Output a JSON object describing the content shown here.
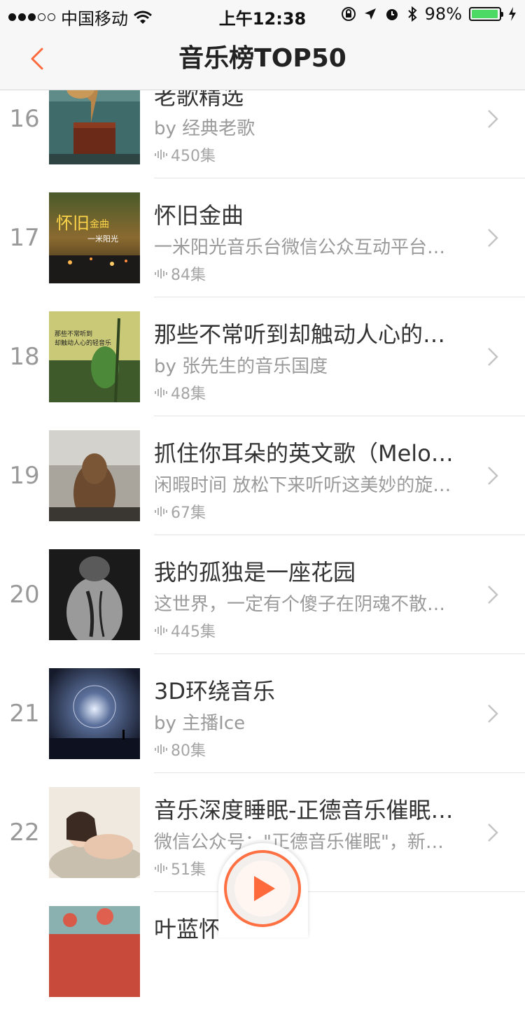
{
  "status_bar": {
    "carrier": "中国移动",
    "time": "上午12:38",
    "battery": "98%",
    "battery_level": 0.98
  },
  "nav": {
    "title": "音乐榜TOP50",
    "back_icon": "chevron-left-icon"
  },
  "items": [
    {
      "rank": "16",
      "title": "老歌精选",
      "subtitle": "by 经典老歌",
      "episodes": "450集"
    },
    {
      "rank": "17",
      "title": "怀旧金曲",
      "subtitle": "一米阳光音乐台微信公众互动平台…",
      "episodes": "84集"
    },
    {
      "rank": "18",
      "title": "那些不常听到却触动人心的…",
      "subtitle": "by 张先生的音乐国度",
      "episodes": "48集"
    },
    {
      "rank": "19",
      "title": "抓住你耳朵的英文歌（Melo…",
      "subtitle": "闲暇时间 放松下来听听这美妙的旋…",
      "episodes": "67集"
    },
    {
      "rank": "20",
      "title": "我的孤独是一座花园",
      "subtitle": "这世界，一定有个傻子在阴魂不散…",
      "episodes": "445集"
    },
    {
      "rank": "21",
      "title": "3D环绕音乐",
      "subtitle": "by 主播Ice",
      "episodes": "80集"
    },
    {
      "rank": "22",
      "title": "音乐深度睡眠-正德音乐催眠…",
      "subtitle": "微信公众号：\"正德音乐催眠\"，新…",
      "episodes": "51集"
    },
    {
      "rank": "",
      "title": "叶蓝怀",
      "subtitle": "",
      "episodes": ""
    }
  ],
  "cover_texts": {
    "c17a": "怀旧",
    "c17b": "金曲",
    "c17c": "一米阳光",
    "c18a": "那些不常听到",
    "c18b": "却触动人心的轻音乐"
  },
  "colors": {
    "accent": "#ff6a3d",
    "rank": "#999999",
    "battery": "#4cd964"
  },
  "icons": {
    "play": "play-icon",
    "chevron": "chevron-right-icon",
    "audio": "sound-wave-icon"
  }
}
